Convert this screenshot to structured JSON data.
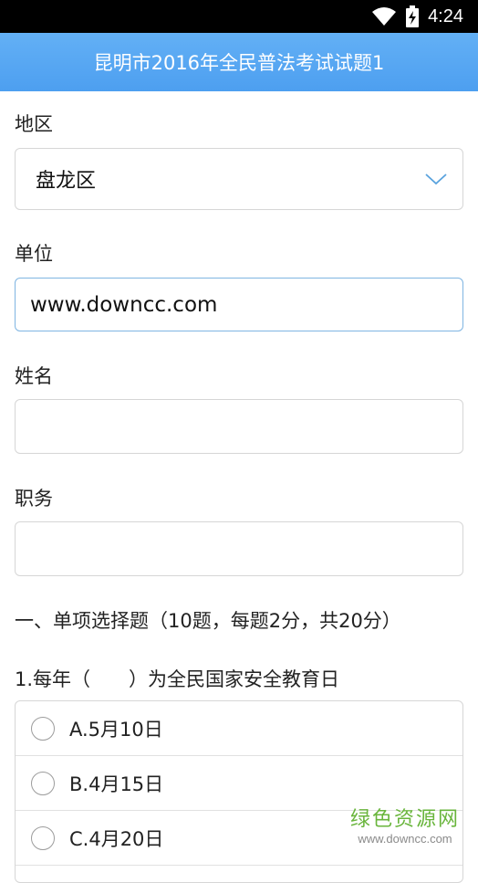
{
  "status_bar": {
    "time": "4:24",
    "icons": [
      "wifi-icon",
      "battery-charging-icon"
    ]
  },
  "header": {
    "title": "昆明市2016年全民普法考试试题1"
  },
  "form": {
    "region": {
      "label": "地区",
      "value": "盘龙区"
    },
    "unit": {
      "label": "单位",
      "value": "www.downcc.com"
    },
    "name": {
      "label": "姓名",
      "value": ""
    },
    "position": {
      "label": "职务",
      "value": ""
    }
  },
  "quiz": {
    "section_title": "一、单项选择题（10题，每题2分，共20分）",
    "question": "1.每年（　　）为全民国家安全教育日",
    "options": [
      "A.5月10日",
      "B.4月15日",
      "C.4月20日"
    ]
  },
  "watermark": {
    "main": "绿色资源网",
    "sub": "www.downcc.com"
  },
  "colors": {
    "header_gradient_top": "#63b0f5",
    "header_gradient_bottom": "#4d9ff0",
    "active_border": "#7fb5e2",
    "watermark_green": "#69b53c"
  }
}
